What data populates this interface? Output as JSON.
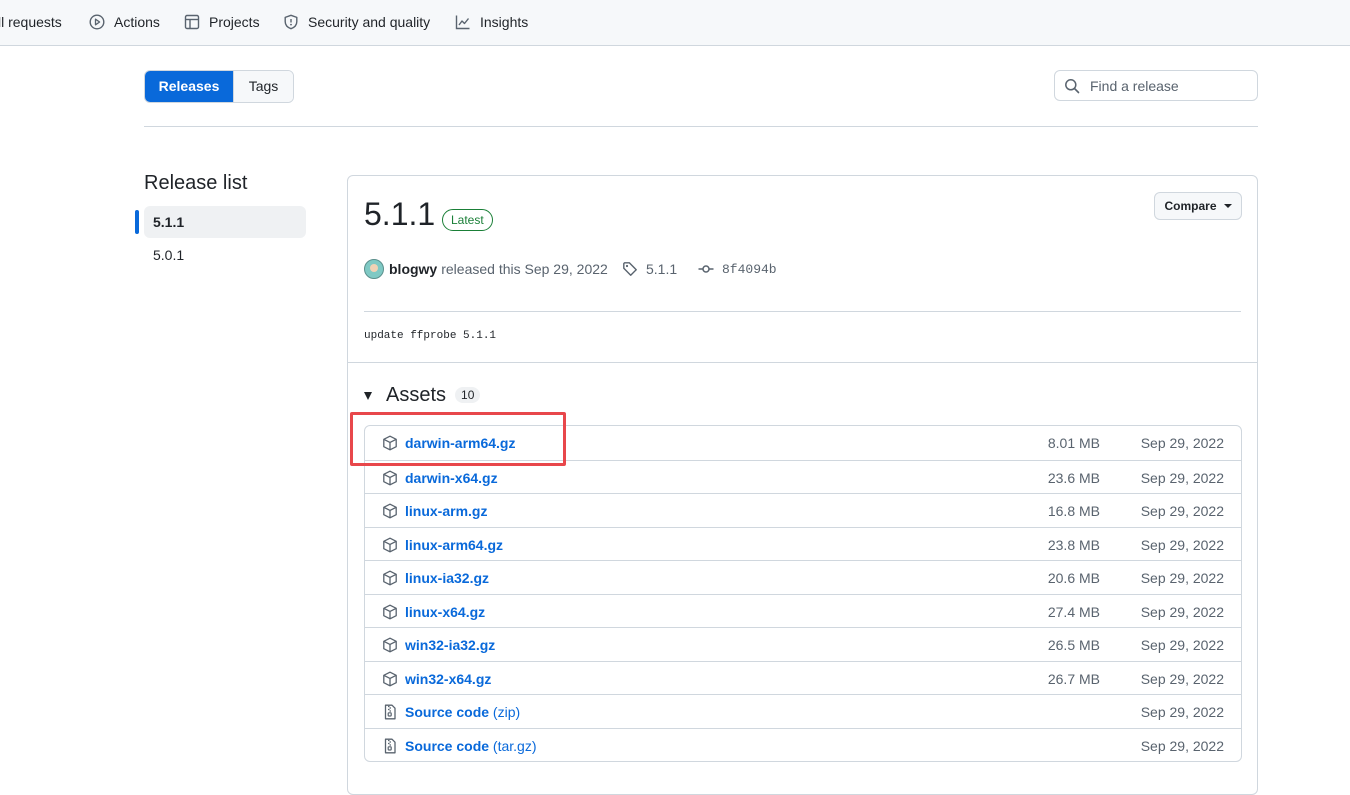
{
  "repo_nav": {
    "items": [
      {
        "label": "ll requests",
        "icon": "pull-request-icon"
      },
      {
        "label": "Actions",
        "icon": "play-icon"
      },
      {
        "label": "Projects",
        "icon": "table-icon"
      },
      {
        "label": "Security and quality",
        "icon": "shield-icon"
      },
      {
        "label": "Insights",
        "icon": "graph-icon"
      }
    ]
  },
  "toolbar": {
    "releases_label": "Releases",
    "tags_label": "Tags",
    "search_placeholder": "Find a release"
  },
  "sidebar": {
    "title": "Release list",
    "items": [
      {
        "label": "5.1.1",
        "active": true
      },
      {
        "label": "5.0.1",
        "active": false
      }
    ]
  },
  "release": {
    "version": "5.1.1",
    "badge": "Latest",
    "compare_label": "Compare",
    "author": "blogwy",
    "released_text": "released this Sep 29, 2022",
    "tag": "5.1.1",
    "commit": "8f4094b",
    "description": "update ffprobe 5.1.1"
  },
  "assets": {
    "title": "Assets",
    "count": "10",
    "items": [
      {
        "name": "darwin-arm64.gz",
        "ext": "",
        "size": "8.01 MB",
        "date": "Sep 29, 2022",
        "icon": "package-icon"
      },
      {
        "name": "darwin-x64.gz",
        "ext": "",
        "size": "23.6 MB",
        "date": "Sep 29, 2022",
        "icon": "package-icon"
      },
      {
        "name": "linux-arm.gz",
        "ext": "",
        "size": "16.8 MB",
        "date": "Sep 29, 2022",
        "icon": "package-icon"
      },
      {
        "name": "linux-arm64.gz",
        "ext": "",
        "size": "23.8 MB",
        "date": "Sep 29, 2022",
        "icon": "package-icon"
      },
      {
        "name": "linux-ia32.gz",
        "ext": "",
        "size": "20.6 MB",
        "date": "Sep 29, 2022",
        "icon": "package-icon"
      },
      {
        "name": "linux-x64.gz",
        "ext": "",
        "size": "27.4 MB",
        "date": "Sep 29, 2022",
        "icon": "package-icon"
      },
      {
        "name": "win32-ia32.gz",
        "ext": "",
        "size": "26.5 MB",
        "date": "Sep 29, 2022",
        "icon": "package-icon"
      },
      {
        "name": "win32-x64.gz",
        "ext": "",
        "size": "26.7 MB",
        "date": "Sep 29, 2022",
        "icon": "package-icon"
      },
      {
        "name": "Source code",
        "ext": "(zip)",
        "size": "",
        "date": "Sep 29, 2022",
        "icon": "file-zip-icon"
      },
      {
        "name": "Source code",
        "ext": "(tar.gz)",
        "size": "",
        "date": "Sep 29, 2022",
        "icon": "file-zip-icon"
      }
    ]
  },
  "colors": {
    "accent": "#0969da",
    "latest_badge": "#1a7f37",
    "highlight_box": "#e8474b"
  }
}
